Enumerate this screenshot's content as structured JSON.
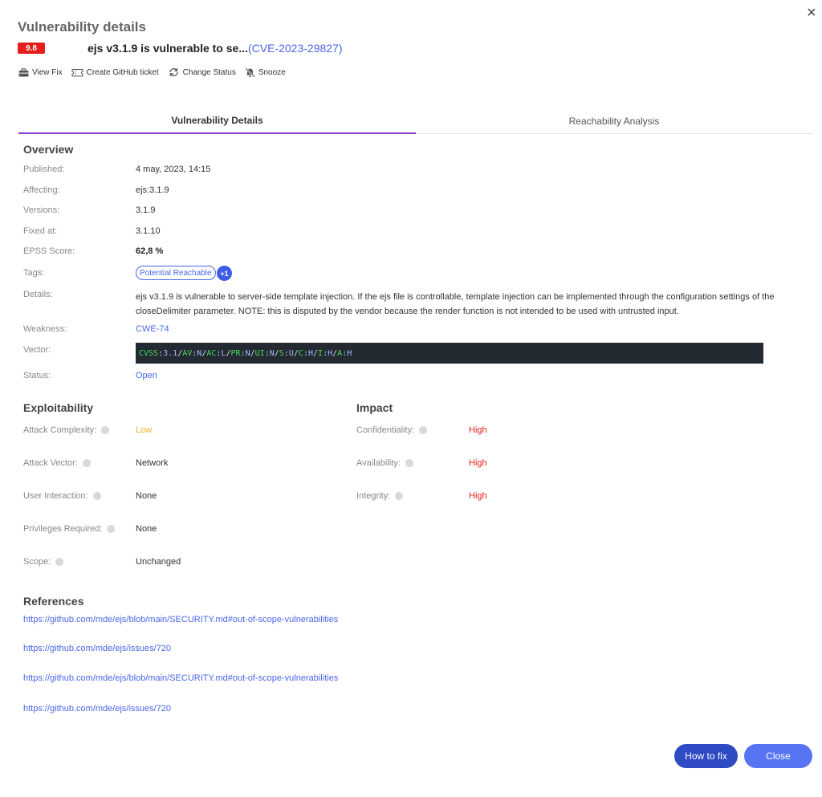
{
  "header": {
    "title": "Vulnerability details",
    "close_glyph": "×",
    "score": "9.8",
    "cve_title": "ejs v3.1.9 is vulnerable to se...",
    "cve_id": "(CVE-2023-29827)"
  },
  "actions": [
    {
      "label": "View Fix",
      "icon": "toolbox-icon"
    },
    {
      "label": "Create GitHub ticket",
      "icon": "ticket-icon"
    },
    {
      "label": "Change Status",
      "icon": "refresh-icon"
    },
    {
      "label": "Snooze",
      "icon": "bell-off-icon"
    }
  ],
  "tabs": [
    "Vulnerability Details",
    "Reachability Analysis"
  ],
  "overview": {
    "heading": "Overview",
    "published_label": "Published:",
    "published": "4 may, 2023, 14:15",
    "affecting_label": "Affecting:",
    "affecting": "ejs:3.1.9",
    "versions_label": "Versions:",
    "versions": "3.1.9",
    "fixed_label": "Fixed at:",
    "fixed": "3.1.10",
    "epss_label": "EPSS Score:",
    "epss": "62,8 %",
    "tags_label": "Tags:",
    "tag": "Potential Reachable",
    "tag_more": "+1",
    "details_label": "Details:",
    "details": "ejs v3.1.9 is vulnerable to server-side template injection. If the ejs file is controllable, template injection can be implemented through the configuration settings of the closeDelimiter parameter. NOTE: this is disputed by the vendor because the render function is not intended to be used with untrusted input.",
    "weakness_label": "Weakness:",
    "weakness": "CWE-74",
    "vector_label": "Vector:",
    "vector_parts": [
      {
        "k": "CVSS",
        "v": "3.1"
      },
      {
        "k": "AV",
        "v": "N"
      },
      {
        "k": "AC",
        "v": "L"
      },
      {
        "k": "PR",
        "v": "N"
      },
      {
        "k": "UI",
        "v": "N"
      },
      {
        "k": "S",
        "v": "U"
      },
      {
        "k": "C",
        "v": "H"
      },
      {
        "k": "I",
        "v": "H"
      },
      {
        "k": "A",
        "v": "H"
      }
    ],
    "status_label": "Status:",
    "status": "Open"
  },
  "exploitability": {
    "heading": "Exploitability",
    "items": [
      {
        "label": "Attack Complexity:",
        "value": "Low"
      },
      {
        "label": "Attack Vector:",
        "value": "Network"
      },
      {
        "label": "User Interaction:",
        "value": "None"
      },
      {
        "label": "Privileges Required:",
        "value": "None"
      },
      {
        "label": "Scope:",
        "value": "Unchanged"
      }
    ]
  },
  "impact": {
    "heading": "Impact",
    "items": [
      {
        "label": "Confidentiality:",
        "value": "High"
      },
      {
        "label": "Availability:",
        "value": "High"
      },
      {
        "label": "Integrity:",
        "value": "High"
      }
    ]
  },
  "references": {
    "heading": "References",
    "links": [
      "https://github.com/mde/ejs/blob/main/SECURITY.md#out-of-scope-vulnerabilities",
      "https://github.com/mde/ejs/issues/720",
      "https://github.com/mde/ejs/blob/main/SECURITY.md#out-of-scope-vulnerabilities",
      "https://github.com/mde/ejs/issues/720"
    ]
  },
  "buttons": {
    "how_to_fix": "How to fix",
    "close": "Close"
  },
  "colors": {
    "accent": "#4a66e8",
    "tab_indicator": "#8a3bd1",
    "critical": "#e41d1d",
    "high": "#e32020",
    "low": "#f0b428",
    "button_primary": "#2f4bc4",
    "button_secondary": "#5775f2"
  }
}
